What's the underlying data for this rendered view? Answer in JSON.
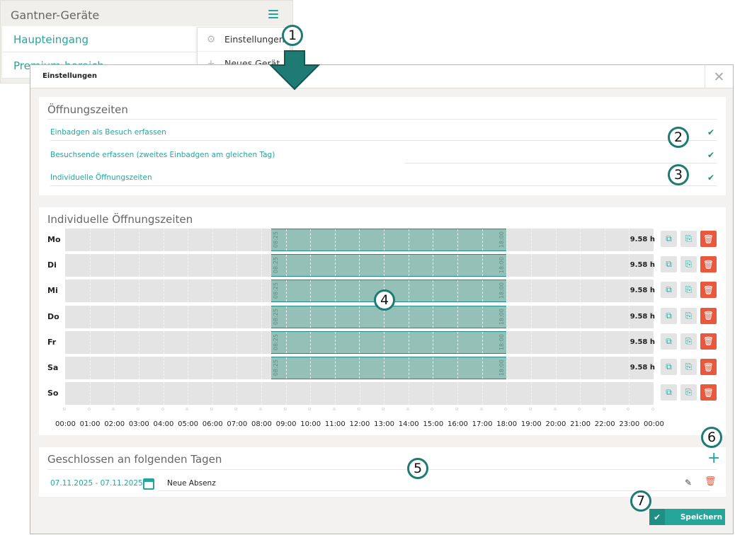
{
  "background_panel": {
    "title": "Gantner-Geräte",
    "items": [
      "Haupteingang",
      "Premium-bereich"
    ]
  },
  "dropdown": {
    "items": [
      {
        "label": "Einstellungen",
        "icon": "gear-icon"
      },
      {
        "label": "Neues Gerät",
        "icon": "plus-icon"
      }
    ]
  },
  "callouts": [
    "1",
    "2",
    "3",
    "4",
    "5",
    "6",
    "7"
  ],
  "modal": {
    "title": "Einstellungen",
    "close": "✕"
  },
  "opening_hours": {
    "title": "Öffnungszeiten",
    "options": [
      {
        "label": "Einbadgen als Besuch erfassen",
        "checked": true
      },
      {
        "label": "Besuchsende erfassen (zweites Einbadgen am gleichen Tag)",
        "checked": true
      },
      {
        "label": "Individuelle Öffnungszeiten",
        "checked": true
      }
    ]
  },
  "individual_hours": {
    "title": "Individuelle Öffnungszeiten",
    "days": [
      {
        "day": "Mo",
        "start": "08:25",
        "end": "18:00",
        "hours": "9.58 h"
      },
      {
        "day": "Di",
        "start": "08:25",
        "end": "18:00",
        "hours": "9.58 h"
      },
      {
        "day": "Mi",
        "start": "08:25",
        "end": "18:00",
        "hours": "9.58 h"
      },
      {
        "day": "Do",
        "start": "08:25",
        "end": "18:00",
        "hours": "9.58 h"
      },
      {
        "day": "Fr",
        "start": "08:25",
        "end": "18:00",
        "hours": "9.58 h"
      },
      {
        "day": "Sa",
        "start": "08:25",
        "end": "18:00",
        "hours": "9.58 h"
      },
      {
        "day": "So",
        "start": "",
        "end": "",
        "hours": ""
      }
    ],
    "axis": [
      "00:00",
      "01:00",
      "02:00",
      "03:00",
      "04:00",
      "05:00",
      "06:00",
      "07:00",
      "08:00",
      "09:00",
      "10:00",
      "11:00",
      "12:00",
      "13:00",
      "14:00",
      "15:00",
      "16:00",
      "17:00",
      "18:00",
      "19:00",
      "20:00",
      "21:00",
      "22:00",
      "23:00",
      "00:00"
    ],
    "colors": {
      "block": "#94c0b8",
      "track": "#e4e4e4",
      "delete": "#e9583c"
    }
  },
  "closed_days": {
    "title": "Geschlossen an folgenden Tagen",
    "add": "+",
    "entries": [
      {
        "range": "07.11.2025 - 07.11.2025",
        "name": "Neue Absenz"
      }
    ]
  },
  "footer": {
    "save_label": "Speichern"
  },
  "accent_color": "#26a69a"
}
